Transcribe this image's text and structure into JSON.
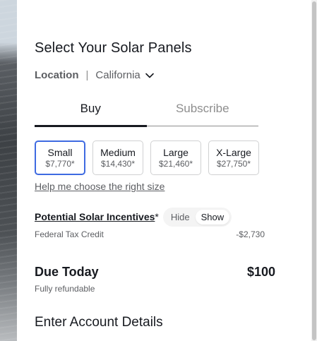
{
  "page": {
    "title": "Select Your Solar Panels"
  },
  "location": {
    "label": "Location",
    "separator": "|",
    "value": "California"
  },
  "tabs": [
    {
      "label": "Buy",
      "active": true
    },
    {
      "label": "Subscribe",
      "active": false
    }
  ],
  "sizes": [
    {
      "name": "Small",
      "price": "$7,770*",
      "selected": true
    },
    {
      "name": "Medium",
      "price": "$14,430*",
      "selected": false
    },
    {
      "name": "Large",
      "price": "$21,460*",
      "selected": false
    },
    {
      "name": "X-Large",
      "price": "$27,750*",
      "selected": false
    }
  ],
  "help_link": "Help me choose the right size",
  "incentives": {
    "label": "Potential Solar Incentives",
    "asterisk": "*",
    "toggle": {
      "hide": "Hide",
      "show": "Show",
      "selected": "Show"
    }
  },
  "credit": {
    "label": "Federal Tax Credit",
    "value": "-$2,730"
  },
  "due": {
    "label": "Due Today",
    "amount": "$100",
    "note": "Fully refundable"
  },
  "account": {
    "title": "Enter Account Details"
  },
  "colors": {
    "accent": "#3e6ae1",
    "text": "#171a20",
    "muted": "#5c5e62"
  }
}
